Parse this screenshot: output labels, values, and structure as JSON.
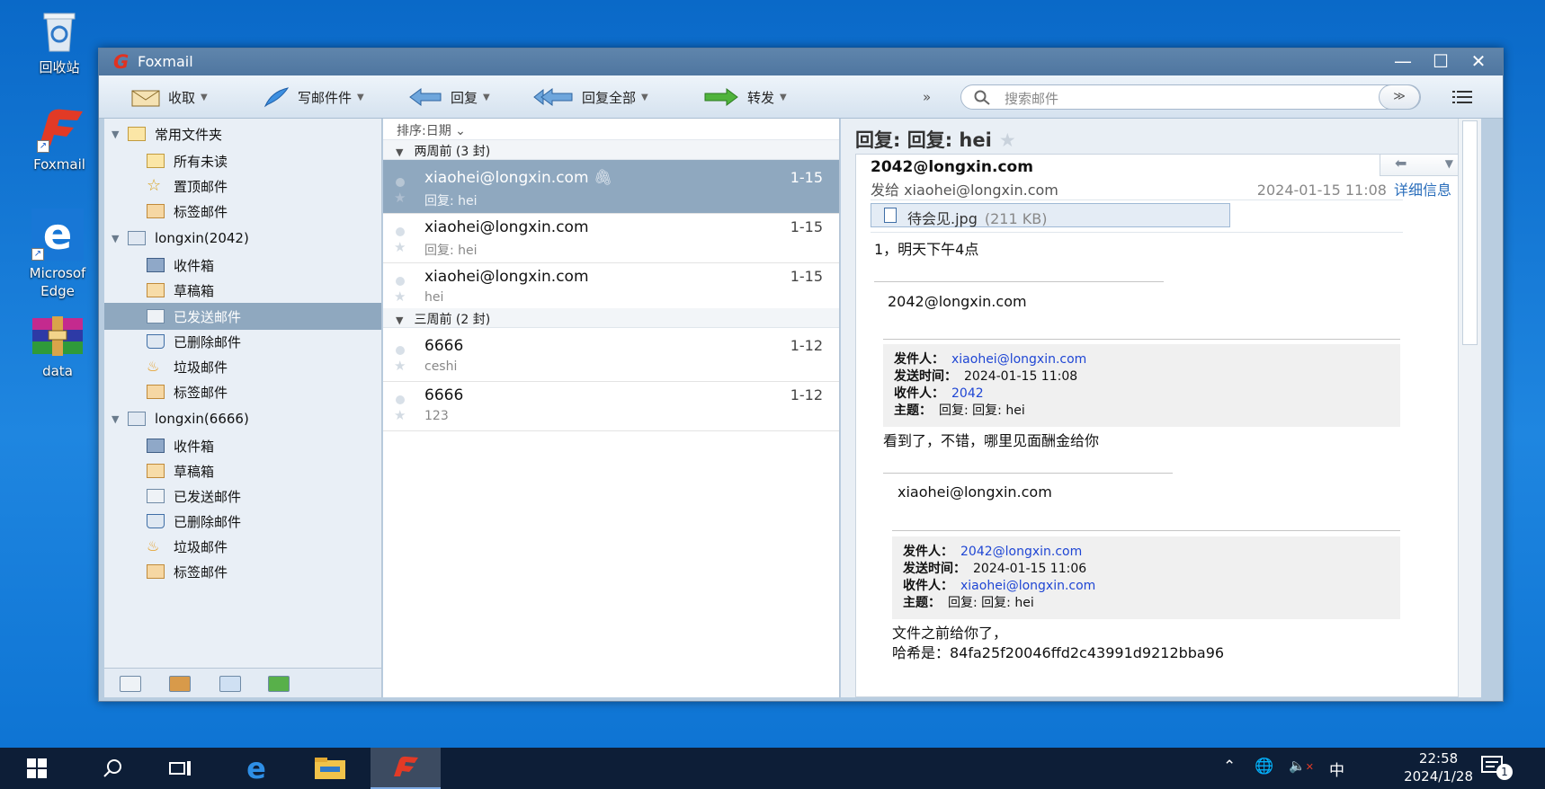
{
  "desktop": {
    "icons": [
      {
        "label": "回收站"
      },
      {
        "label": "Foxmail"
      },
      {
        "label": "Microsof Edge"
      },
      {
        "label": "data"
      }
    ]
  },
  "window": {
    "title": "Foxmail",
    "toolbar": {
      "receive": "收取",
      "compose": "写邮件件",
      "reply": "回复",
      "reply_all": "回复全部",
      "forward": "转发",
      "more": "»",
      "search_placeholder": "搜索邮件"
    },
    "folders": {
      "common": {
        "label": "常用文件夹",
        "items": [
          "所有未读",
          "置顶邮件",
          "标签邮件"
        ]
      },
      "account1": {
        "label": "longxin(2042)",
        "items": [
          "收件箱",
          "草稿箱",
          "已发送邮件",
          "已删除邮件",
          "垃圾邮件",
          "标签邮件"
        ]
      },
      "account2": {
        "label": "longxin(6666)",
        "items": [
          "收件箱",
          "草稿箱",
          "已发送邮件",
          "已删除邮件",
          "垃圾邮件",
          "标签邮件"
        ]
      }
    },
    "message_list": {
      "sort_label": "排序:日期",
      "groups": [
        {
          "label": "两周前 (3 封)",
          "messages": [
            {
              "from": "xiaohei@longxin.com",
              "date": "1-15",
              "subject": "回复: hei",
              "attachment": true
            },
            {
              "from": "xiaohei@longxin.com",
              "date": "1-15",
              "subject": "回复: hei"
            },
            {
              "from": "xiaohei@longxin.com",
              "date": "1-15",
              "subject": "hei"
            }
          ]
        },
        {
          "label": "三周前 (2 封)",
          "messages": [
            {
              "from": "6666",
              "date": "1-12",
              "subject": "ceshi"
            },
            {
              "from": "6666",
              "date": "1-12",
              "subject": "123"
            }
          ]
        }
      ]
    },
    "reader": {
      "subject": "回复: 回复: hei",
      "sender": "2042@longxin.com",
      "send_to": "发给 xiaohei@longxin.com",
      "date": "2024-01-15 11:08",
      "details_link": "详细信息",
      "attachment": {
        "name": "待会见.jpg",
        "size": "(211 KB)"
      },
      "body_line1": "1，明天下午4点",
      "sig1": "2042@longxin.com",
      "quote1": {
        "from_label": "发件人：",
        "from": "xiaohei@longxin.com",
        "time_label": "发送时间：",
        "time": "2024-01-15 11:08",
        "to_label": "收件人：",
        "to": "2042",
        "subject_label": "主题：",
        "subject": "回复: 回复: hei"
      },
      "body_line2": "看到了，不错，哪里见面酬金给你",
      "sig2": "xiaohei@longxin.com",
      "quote2": {
        "from_label": "发件人：",
        "from": "2042@longxin.com",
        "time_label": "发送时间：",
        "time": "2024-01-15 11:06",
        "to_label": "收件人：",
        "to": "xiaohei@longxin.com",
        "subject_label": "主题：",
        "subject": "回复: 回复: hei"
      },
      "body_line3": "文件之前给你了，",
      "body_line4": "哈希是：84fa25f20046ffd2c43991d9212bba96"
    }
  },
  "taskbar": {
    "ime": "中",
    "time": "22:58",
    "date": "2024/1/28",
    "notification_count": "1"
  }
}
